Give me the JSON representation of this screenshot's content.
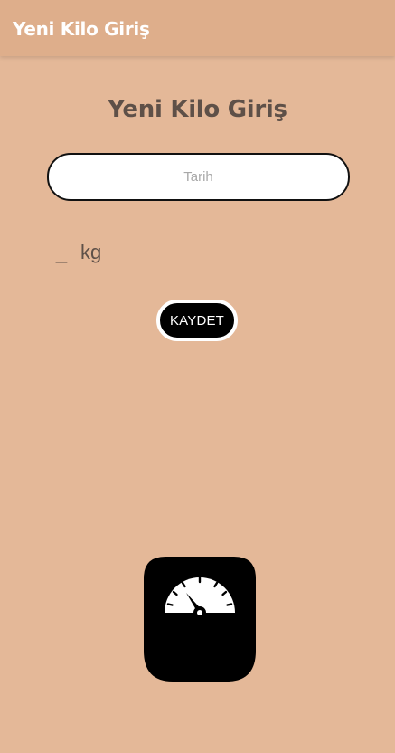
{
  "appbar": {
    "title": "Yeni Kilo Giriş"
  },
  "form": {
    "heading": "Yeni Kilo Giriş",
    "date_placeholder": "Tarih",
    "weight_value": "_",
    "weight_unit": "kg",
    "save_label": "KAYDET"
  },
  "illustration": {
    "icon": "bathroom-scale-icon"
  },
  "colors": {
    "background": "#e4b898",
    "appbar": "#deae8b",
    "text": "#5e5048",
    "button": "#000000"
  }
}
